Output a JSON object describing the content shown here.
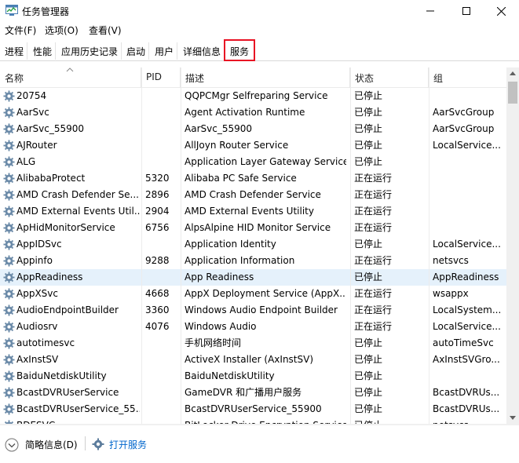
{
  "window": {
    "title": "任务管理器"
  },
  "menu": {
    "file": "文件(F)",
    "options": "选项(O)",
    "view": "查看(V)"
  },
  "tabs": [
    "进程",
    "性能",
    "应用历史记录",
    "启动",
    "用户",
    "详细信息",
    "服务"
  ],
  "active_tab": "服务",
  "columns": {
    "name": "名称",
    "pid": "PID",
    "desc": "描述",
    "status": "状态",
    "group": "组"
  },
  "services": [
    {
      "name": "20754",
      "pid": "",
      "desc": "QQPCMgr Selfreparing Service",
      "status": "已停止",
      "group": ""
    },
    {
      "name": "AarSvc",
      "pid": "",
      "desc": "Agent Activation Runtime",
      "status": "已停止",
      "group": "AarSvcGroup"
    },
    {
      "name": "AarSvc_55900",
      "pid": "",
      "desc": "AarSvc_55900",
      "status": "已停止",
      "group": "AarSvcGroup"
    },
    {
      "name": "AJRouter",
      "pid": "",
      "desc": "AllJoyn Router Service",
      "status": "已停止",
      "group": "LocalService..."
    },
    {
      "name": "ALG",
      "pid": "",
      "desc": "Application Layer Gateway Service",
      "status": "已停止",
      "group": ""
    },
    {
      "name": "AlibabaProtect",
      "pid": "5320",
      "desc": "Alibaba PC Safe Service",
      "status": "正在运行",
      "group": ""
    },
    {
      "name": "AMD Crash Defender Se...",
      "pid": "2896",
      "desc": "AMD Crash Defender Service",
      "status": "正在运行",
      "group": ""
    },
    {
      "name": "AMD External Events Util...",
      "pid": "2904",
      "desc": "AMD External Events Utility",
      "status": "正在运行",
      "group": ""
    },
    {
      "name": "ApHidMonitorService",
      "pid": "6756",
      "desc": "AlpsAlpine HID Monitor Service",
      "status": "正在运行",
      "group": ""
    },
    {
      "name": "AppIDSvc",
      "pid": "",
      "desc": "Application Identity",
      "status": "已停止",
      "group": "LocalService..."
    },
    {
      "name": "Appinfo",
      "pid": "9288",
      "desc": "Application Information",
      "status": "正在运行",
      "group": "netsvcs"
    },
    {
      "name": "AppReadiness",
      "pid": "",
      "desc": "App Readiness",
      "status": "已停止",
      "group": "AppReadiness"
    },
    {
      "name": "AppXSvc",
      "pid": "4668",
      "desc": "AppX Deployment Service (AppX...",
      "status": "正在运行",
      "group": "wsappx"
    },
    {
      "name": "AudioEndpointBuilder",
      "pid": "3360",
      "desc": "Windows Audio Endpoint Builder",
      "status": "正在运行",
      "group": "LocalSystem..."
    },
    {
      "name": "Audiosrv",
      "pid": "4076",
      "desc": "Windows Audio",
      "status": "正在运行",
      "group": "LocalService..."
    },
    {
      "name": "autotimesvc",
      "pid": "",
      "desc": "手机网络时间",
      "status": "已停止",
      "group": "autoTimeSvc"
    },
    {
      "name": "AxInstSV",
      "pid": "",
      "desc": "ActiveX Installer (AxInstSV)",
      "status": "已停止",
      "group": "AxInstSVGro..."
    },
    {
      "name": "BaiduNetdiskUtility",
      "pid": "",
      "desc": "BaiduNetdiskUtility",
      "status": "已停止",
      "group": ""
    },
    {
      "name": "BcastDVRUserService",
      "pid": "",
      "desc": "GameDVR 和广播用户服务",
      "status": "已停止",
      "group": "BcastDVRUs..."
    },
    {
      "name": "BcastDVRUserService_55...",
      "pid": "",
      "desc": "BcastDVRUserService_55900",
      "status": "已停止",
      "group": "BcastDVRUs..."
    },
    {
      "name": "BDESVC",
      "pid": "",
      "desc": "BitLocker Drive Encryption Service",
      "status": "已停止",
      "group": "netsvcs"
    }
  ],
  "selected_row": 11,
  "footer": {
    "brief": "简略信息(D)",
    "open_services": "打开服务"
  },
  "colors": {
    "active_tab_border": "#e81123",
    "selected_row": "#e5f1fb"
  }
}
